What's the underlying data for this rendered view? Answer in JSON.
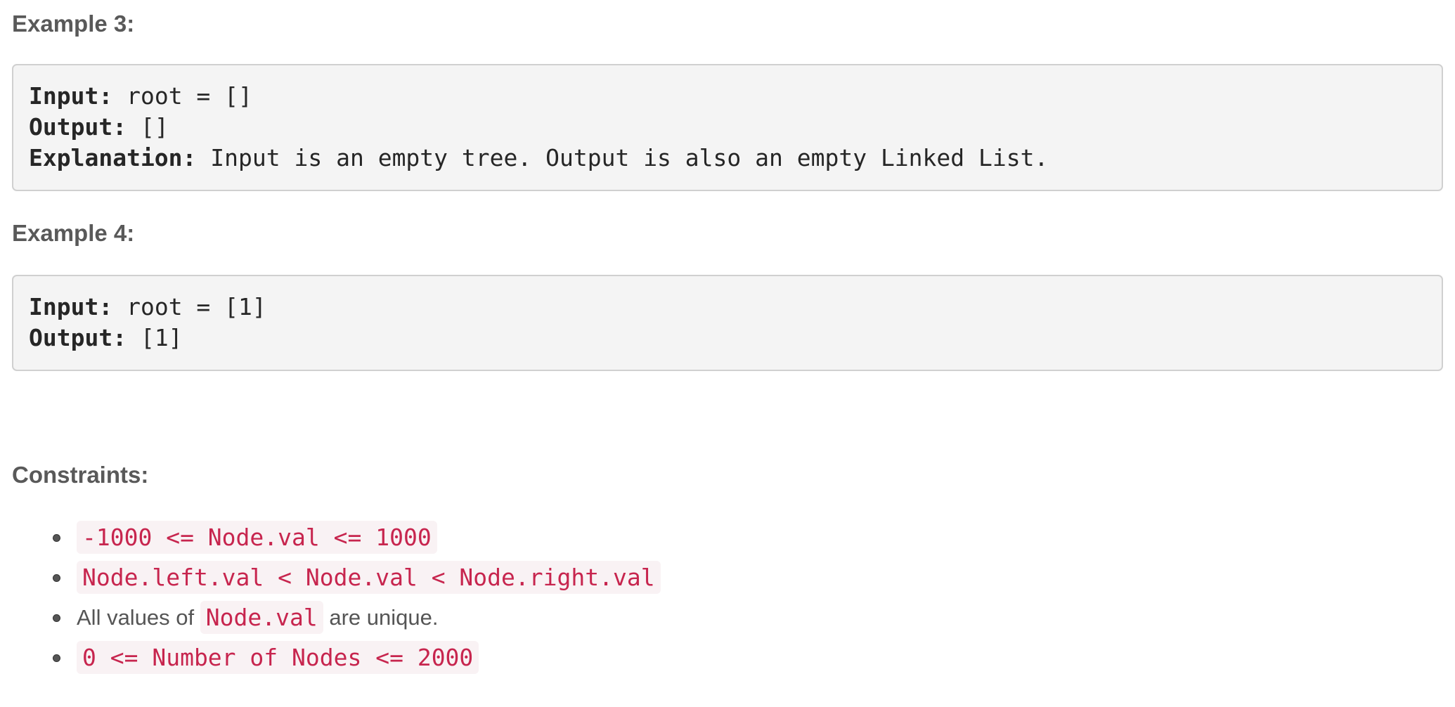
{
  "example3": {
    "heading": "Example 3:",
    "input_label": "Input:",
    "input_value": " root = []",
    "output_label": "Output:",
    "output_value": " []",
    "explanation_label": "Explanation:",
    "explanation_value": " Input is an empty tree. Output is also an empty Linked List."
  },
  "example4": {
    "heading": "Example 4:",
    "input_label": "Input:",
    "input_value": " root = [1]",
    "output_label": "Output:",
    "output_value": " [1]"
  },
  "constraints": {
    "heading": "Constraints:",
    "item1_code": "-1000 <= Node.val <= 1000",
    "item2_code": "Node.left.val < Node.val < Node.right.val",
    "item3_text_before": "All values of ",
    "item3_code": "Node.val",
    "item3_text_after": " are unique.",
    "item4_code": "0 <= Number of Nodes <= 2000"
  }
}
